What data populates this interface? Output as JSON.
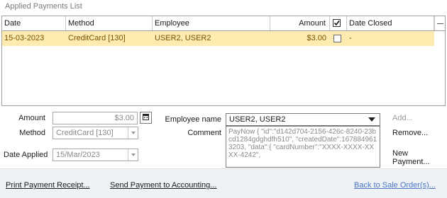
{
  "section_title": "Applied Payments List",
  "grid": {
    "columns": {
      "date": "Date",
      "method": "Method",
      "employee": "Employee",
      "amount": "Amount",
      "date_closed": "Date Closed"
    },
    "header_checkbox_checked": true,
    "rows": [
      {
        "date": "15-03-2023",
        "method": "CreditCard [130]",
        "employee": "USER2, USER2",
        "amount": "$3.00",
        "checked": false,
        "date_closed": "-"
      }
    ],
    "selected_row_color": "#fdebb0"
  },
  "form": {
    "amount_label": "Amount",
    "amount_value": "$3.00",
    "method_label": "Method",
    "method_value": "CreditCard [130]",
    "date_applied_label": "Date Applied",
    "date_applied_value": "15/Mar/2023",
    "employee_name_label": "Employee name",
    "employee_name_value": "USER2, USER2",
    "comment_label": "Comment",
    "comment_value": "PayNow   {    \"id\":\"d142d704-2156-426c-8240-23bcd1284gdghdfh510\",    \"createdDate\":1678849613203,       \"data\":{       \"cardNumber\":\"XXXX-XXXX-XXXX-4242\","
  },
  "actions": {
    "add": "Add...",
    "remove": "Remove...",
    "new_payment": "New Payment..."
  },
  "footer": {
    "print_receipt": "Print Payment Receipt...",
    "send_accounting": "Send Payment to Accounting...",
    "back_to_sale": "Back to Sale Order(s)..."
  },
  "icons": {
    "calculator": "calculator-icon",
    "dropdown": "chevron-down-icon",
    "checkbox": "checkbox-icon"
  }
}
